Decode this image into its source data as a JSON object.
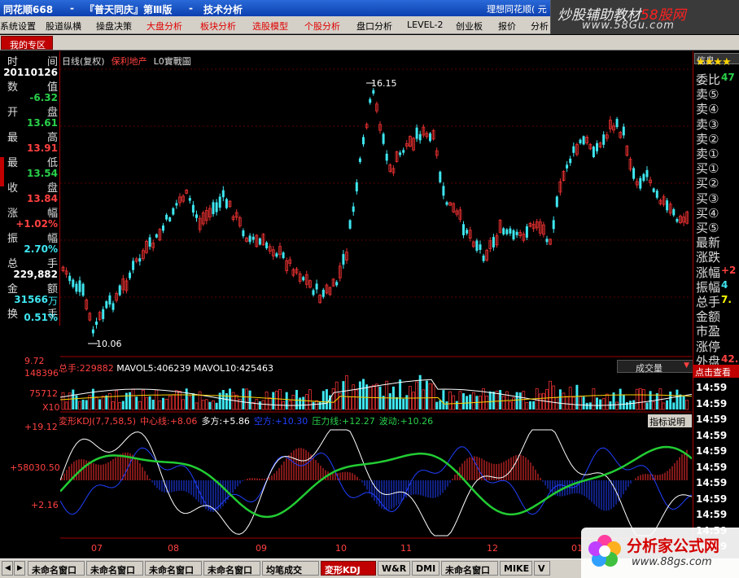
{
  "titlebar": {
    "app": "同花顺668",
    "separator": "-",
    "stock_title": "『普天同庆』第Ⅲ版",
    "separator2": "-",
    "module": "技术分析",
    "right_text": "理想同花顺( 元"
  },
  "brand_banner": {
    "title_prefix": "炒股辅助教材",
    "title_highlight": "58股网",
    "url": "www.58Gu.com"
  },
  "menu": {
    "items": [
      {
        "label": "系统设置",
        "red": false
      },
      {
        "label": "股道纵横",
        "red": false
      },
      {
        "label": "操盘决策",
        "red": false
      },
      {
        "label": "大盘分析",
        "red": true
      },
      {
        "label": "板块分析",
        "red": true
      },
      {
        "label": "选股模型",
        "red": true
      },
      {
        "label": "个股分析",
        "red": true
      },
      {
        "label": "盘口分析",
        "red": false
      },
      {
        "label": "LEVEL-2",
        "red": false
      },
      {
        "label": "创业板",
        "red": false
      },
      {
        "label": "报价",
        "red": false
      },
      {
        "label": "分析",
        "red": false
      }
    ]
  },
  "zone": {
    "my_zone": "我的专区"
  },
  "left_panel": {
    "rows": [
      {
        "a": "时",
        "b": "间",
        "value": "20110126",
        "color": "white"
      },
      {
        "a": "数",
        "b": "值",
        "value": "-6.32",
        "color": "green"
      },
      {
        "a": "开",
        "b": "盘",
        "value": "13.61",
        "color": "green"
      },
      {
        "a": "最",
        "b": "高",
        "value": "13.91",
        "color": "red"
      },
      {
        "a": "最",
        "b": "低",
        "value": "13.54",
        "color": "green"
      },
      {
        "a": "收",
        "b": "盘",
        "value": "13.84",
        "color": "red"
      },
      {
        "a": "涨",
        "b": "幅",
        "value": "+1.02%",
        "color": "red"
      },
      {
        "a": "振",
        "b": "幅",
        "value": "2.70%",
        "color": "cyan"
      },
      {
        "a": "总",
        "b": "手",
        "value": "229,882",
        "color": "white"
      },
      {
        "a": "金",
        "b": "额",
        "value": "31566",
        "unit": "万",
        "color": "cyan"
      },
      {
        "a": "换",
        "b": "手",
        "value": "0.51%",
        "color": "cyan"
      }
    ]
  },
  "kline": {
    "header_type": "日线(复权)",
    "stock_name": "保利地产",
    "indicator": "L0實戰圖",
    "high_label": "16.15",
    "low_label": "10.06"
  },
  "volume": {
    "header": {
      "total_label": "总手:",
      "total_value": "229882",
      "mavol5_label": "MAVOL5:",
      "mavol5_value": "406239",
      "mavol10_label": "MAVOL10:",
      "mavol10_value": "425463"
    },
    "selector": "成交量",
    "y_labels": [
      "148396",
      "75712",
      "X10"
    ],
    "top_price_label": "9.72"
  },
  "kdj": {
    "name": "変形KDJ(7,7,58,5)",
    "center_label": "中心线:",
    "center_value": "+8.06",
    "bull_label": "多方:",
    "bull_value": "+5.86",
    "bear_label": "空方:",
    "bear_value": "+10.30",
    "pressure_label": "压力线:",
    "pressure_value": "+12.27",
    "wave_label": "波动:",
    "wave_value": "+10.26",
    "help": "指标说明",
    "y_labels": [
      "+19.12",
      "+58030.50",
      "+2.16"
    ]
  },
  "x_axis": [
    "07",
    "08",
    "09",
    "10",
    "11",
    "12",
    "01"
  ],
  "right_panel": {
    "info_button": "信息",
    "stars": "★★★★",
    "rows": [
      {
        "label": "委比",
        "value": "47",
        "color": "green"
      },
      {
        "label": "卖⑤",
        "value": "",
        "color": "white"
      },
      {
        "label": "卖④",
        "value": "",
        "color": "white"
      },
      {
        "label": "卖③",
        "value": "",
        "color": "white"
      },
      {
        "label": "卖②",
        "value": "",
        "color": "white"
      },
      {
        "label": "卖①",
        "value": "",
        "color": "white"
      },
      {
        "label": "买①",
        "value": "",
        "color": "white"
      },
      {
        "label": "买②",
        "value": "",
        "color": "white"
      },
      {
        "label": "买③",
        "value": "",
        "color": "white"
      },
      {
        "label": "买④",
        "value": "",
        "color": "white"
      },
      {
        "label": "买⑤",
        "value": "",
        "color": "white"
      },
      {
        "label": "最新",
        "value": "",
        "color": "white"
      },
      {
        "label": "涨跌",
        "value": "",
        "color": "white"
      },
      {
        "label": "涨幅",
        "value": "+2",
        "color": "red"
      },
      {
        "label": "振幅",
        "value": "4",
        "color": "cyan"
      },
      {
        "label": "总手",
        "value": "7.",
        "color": "yellow"
      },
      {
        "label": "金额",
        "value": "",
        "color": "white"
      },
      {
        "label": "市盈",
        "value": "",
        "color": "white"
      },
      {
        "label": "涨停",
        "value": "",
        "color": "white"
      },
      {
        "label": "外盘",
        "value": "42.",
        "color": "red"
      }
    ],
    "click_link": "点击查看",
    "times": [
      "14:59",
      "14:59",
      "14:59",
      "14:59",
      "14:59",
      "14:59",
      "14:59",
      "14:59",
      "14:59",
      "14:59",
      "14:59"
    ]
  },
  "tabs": [
    {
      "label": "未命名窗口",
      "active": false
    },
    {
      "label": "未命名窗口",
      "active": false
    },
    {
      "label": "未命名窗口",
      "active": false
    },
    {
      "label": "未命名窗口",
      "active": false
    },
    {
      "label": "均笔成交",
      "active": false
    },
    {
      "label": "変形KDJ",
      "active": true
    },
    {
      "label": "W&R",
      "active": false
    },
    {
      "label": "DMI",
      "active": false
    },
    {
      "label": "未命名窗口",
      "active": false
    },
    {
      "label": "MIKE",
      "active": false
    },
    {
      "label": "V",
      "active": false
    }
  ],
  "watermark": {
    "title": "分析家公式网",
    "url": "www.88gs.com"
  },
  "colors": {
    "up": "#e83030",
    "down": "#3ee6f0",
    "kdj_white": "#ffffff",
    "kdj_green": "#22cc33",
    "kdj_blue": "#2040ff",
    "kdj_red": "#ff3030"
  }
}
